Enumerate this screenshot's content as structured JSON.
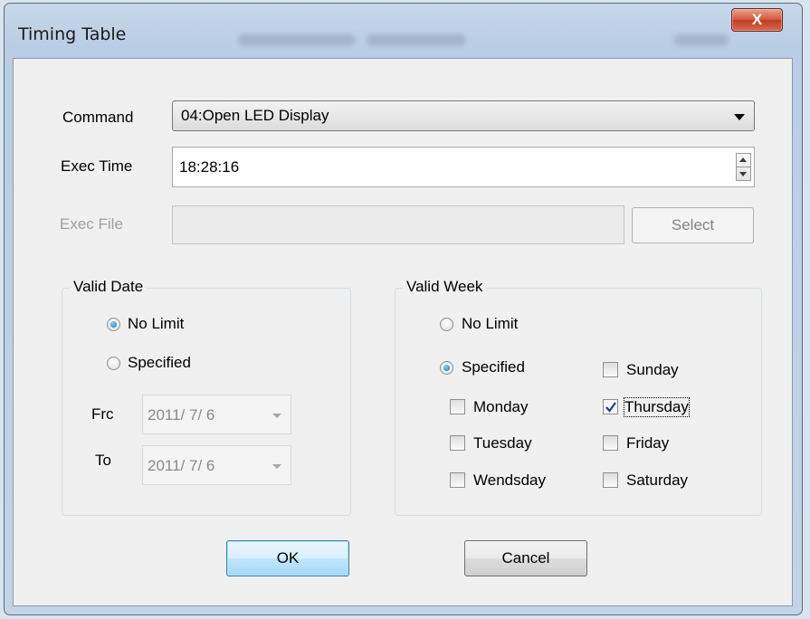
{
  "window": {
    "title": "Timing Table",
    "close_label": "X"
  },
  "form": {
    "command_label": "Command",
    "command_value": "04:Open LED Display",
    "exec_time_label": "Exec Time",
    "exec_time_value": "18:28:16",
    "exec_file_label": "Exec File",
    "exec_file_value": "",
    "select_label": "Select"
  },
  "valid_date": {
    "title": "Valid Date",
    "no_limit_label": "No Limit",
    "specified_label": "Specified",
    "selected": "No Limit",
    "from_label": "Frc",
    "from_value": "2011/ 7/ 6",
    "to_label": "To",
    "to_value": "2011/ 7/ 6"
  },
  "valid_week": {
    "title": "Valid Week",
    "no_limit_label": "No Limit",
    "specified_label": "Specified",
    "selected": "Specified",
    "days": [
      {
        "label": "Sunday",
        "checked": false
      },
      {
        "label": "Monday",
        "checked": false
      },
      {
        "label": "Thursday",
        "checked": true
      },
      {
        "label": "Tuesday",
        "checked": false
      },
      {
        "label": "Friday",
        "checked": false
      },
      {
        "label": "Wendsday",
        "checked": false
      },
      {
        "label": "Saturday",
        "checked": false
      }
    ]
  },
  "buttons": {
    "ok_label": "OK",
    "cancel_label": "Cancel"
  }
}
